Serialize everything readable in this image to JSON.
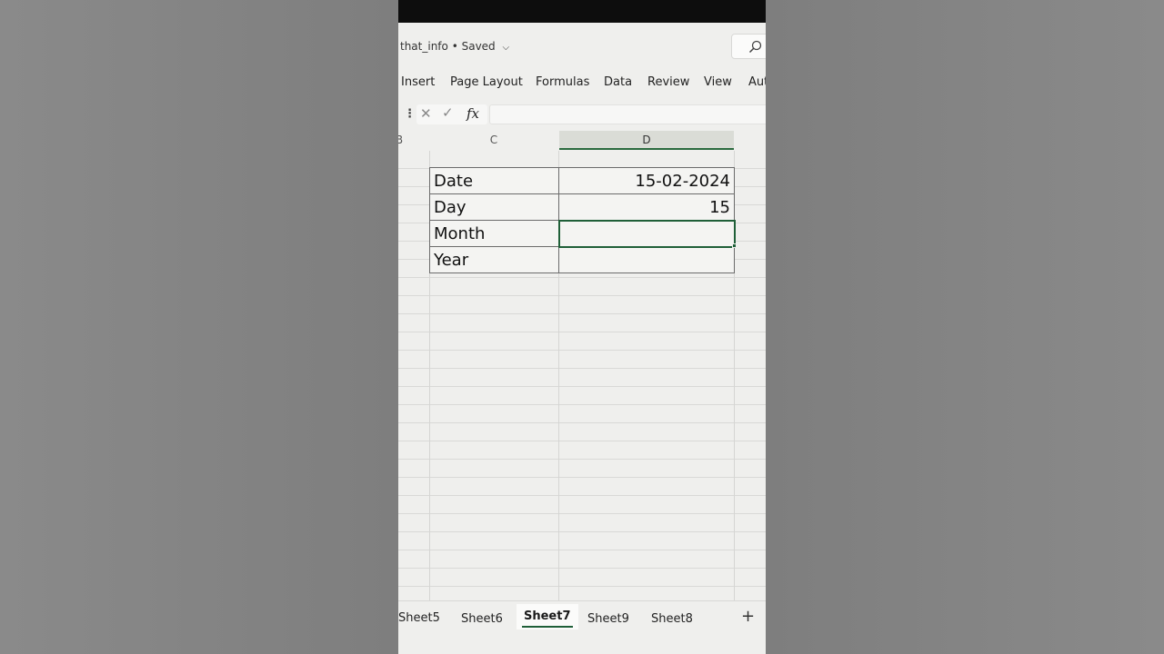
{
  "window": {
    "title": "that_info",
    "save_status": "• Saved"
  },
  "ribbon": {
    "tabs": [
      "Insert",
      "Page Layout",
      "Formulas",
      "Data",
      "Review",
      "View",
      "Aut"
    ]
  },
  "formula_bar": {
    "fx_label": "fx",
    "value": ""
  },
  "columns": [
    "B",
    "C",
    "D"
  ],
  "selected_column": "D",
  "table": {
    "rows": [
      {
        "label": "Date",
        "value": "15-02-2024"
      },
      {
        "label": "Day",
        "value": "15"
      },
      {
        "label": "Month",
        "value": ""
      },
      {
        "label": "Year",
        "value": ""
      }
    ],
    "active_row_index": 2
  },
  "sheets": {
    "tabs": [
      "Sheet5",
      "Sheet6",
      "Sheet7",
      "Sheet9",
      "Sheet8"
    ],
    "active": "Sheet7",
    "add_label": "+"
  },
  "colors": {
    "accent": "#1f5f38",
    "grid_line": "#d9d9d7",
    "background": "#efefed"
  }
}
